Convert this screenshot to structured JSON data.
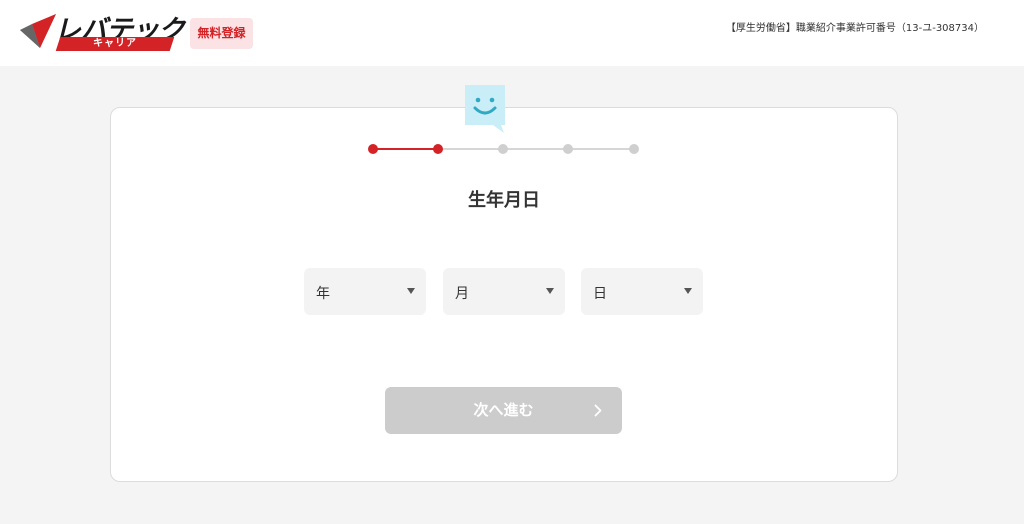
{
  "header": {
    "logo_text": "レバテック",
    "logo_sub": "キャリア",
    "badge": "無料登録",
    "license": "【厚生労働省】職業紹介事業許可番号（13-ユ-308734）"
  },
  "icons": {
    "bubble": "smile-bubble-icon",
    "select_arrow": "caret-down-icon",
    "next": "chevron-right-icon"
  },
  "colors": {
    "accent": "#d42327",
    "bubble": "#c9eef7",
    "disabled": "#cccccc"
  },
  "progress": {
    "total_steps": 5,
    "current_step": 2
  },
  "form": {
    "title": "生年月日",
    "year": {
      "placeholder": "年"
    },
    "month": {
      "placeholder": "月"
    },
    "day": {
      "placeholder": "日"
    },
    "next_label": "次へ進む"
  }
}
